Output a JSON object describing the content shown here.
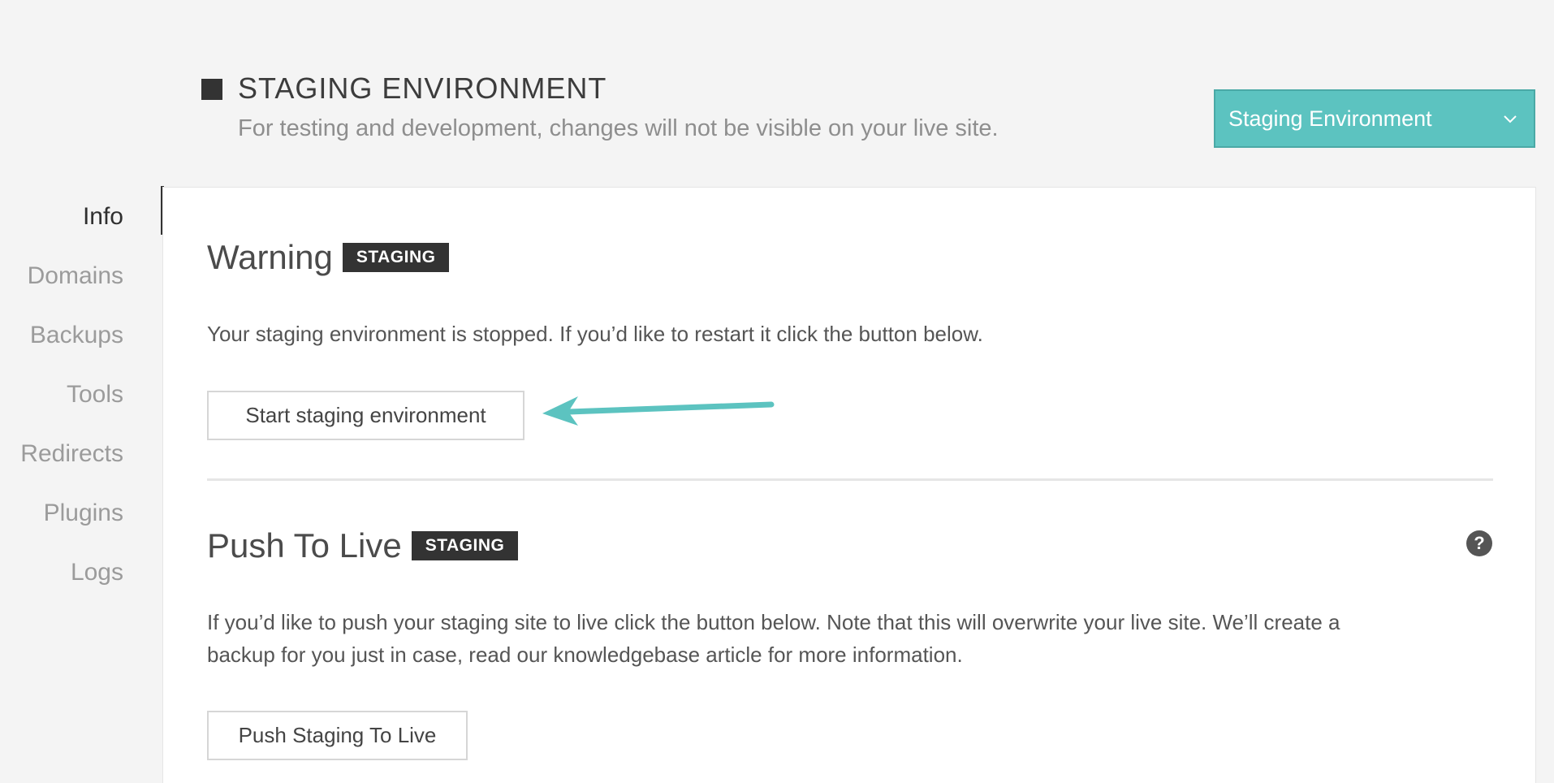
{
  "header": {
    "title": "STAGING ENVIRONMENT",
    "subtitle": "For testing and development, changes will not be visible on your live site."
  },
  "environment_select": {
    "selected": "Staging Environment",
    "chevron_icon": "chevron-down-icon"
  },
  "sidebar": {
    "items": [
      {
        "label": "Info",
        "active": true
      },
      {
        "label": "Domains"
      },
      {
        "label": "Backups"
      },
      {
        "label": "Tools"
      },
      {
        "label": "Redirects"
      },
      {
        "label": "Plugins"
      },
      {
        "label": "Logs"
      }
    ]
  },
  "warning_section": {
    "title": "Warning",
    "badge": "STAGING",
    "text": "Your staging environment is stopped. If you’d like to restart it click the button below.",
    "button_label": "Start staging environment"
  },
  "push_section": {
    "title": "Push To Live",
    "badge": "STAGING",
    "text_line1": "If you’d like to push your staging site to live click the button below. Note that this will overwrite your live site. We’ll create a",
    "text_line2": "backup for you just in case, read our knowledgebase article for more information.",
    "button_label": "Push Staging To Live",
    "help_icon": "question-icon",
    "help_glyph": "?"
  },
  "colors": {
    "accent": "#5cc3c0",
    "badge_bg": "#333333",
    "arrow": "#5cc3c0"
  }
}
